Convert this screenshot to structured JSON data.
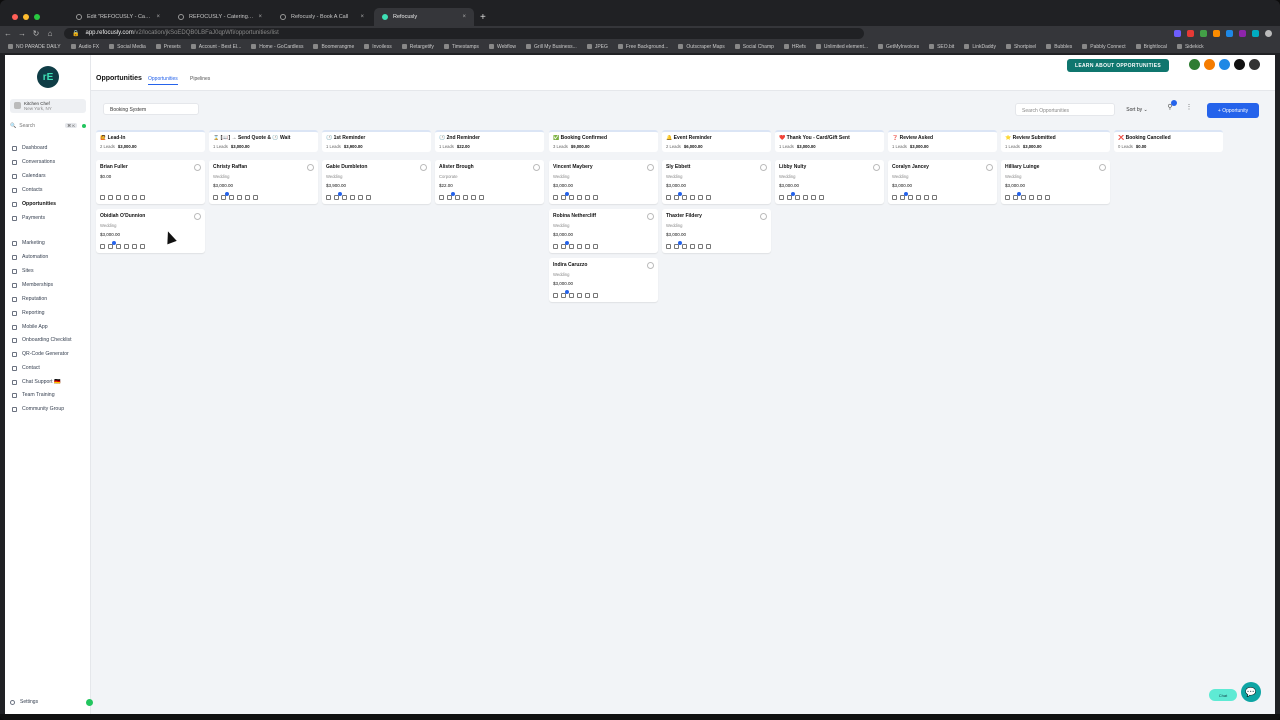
{
  "browser": {
    "tabs": [
      {
        "label": "Edit \"REFOCUSLY - Catering &"
      },
      {
        "label": "REFOCUSLY - Catering & Rei"
      },
      {
        "label": "Refocusly - Book A Call"
      },
      {
        "label": "Refocusly",
        "active": true
      }
    ],
    "url_host": "app.refocusly.com",
    "url_path": "/v2/location/jkSoEDQB0LBFaJ0qpWfi/opportunities/list",
    "bookmarks": [
      "NO PARADE DAILY",
      "Audio FX",
      "Social Media",
      "Presets",
      "Account - Best El...",
      "Home - GoCardless",
      "Boomerangme",
      "Invoiless",
      "Retargetify",
      "Timestamps",
      "Webflow",
      "Grill My Business...",
      "JPEG",
      "Free Background...",
      "Outscraper Maps",
      "Social Champ",
      "HRefs",
      "Unlimited element...",
      "GetMyInvoices",
      "SEO.bit",
      "LinkDaddy",
      "Shortpixel",
      "Bubbles",
      "Pabbly Connect",
      "Brightlocal",
      "Sidekick"
    ]
  },
  "account": {
    "name": "Kitchen Chef",
    "location": "New York, NY"
  },
  "sidebar": {
    "search": "Search",
    "shortcut": "⌘ K",
    "items": [
      {
        "label": "Dashboard"
      },
      {
        "label": "Conversations"
      },
      {
        "label": "Calendars"
      },
      {
        "label": "Contacts"
      },
      {
        "label": "Opportunities",
        "active": true
      },
      {
        "label": "Payments"
      },
      {
        "label": "Marketing"
      },
      {
        "label": "Automation"
      },
      {
        "label": "Sites"
      },
      {
        "label": "Memberships"
      },
      {
        "label": "Reputation"
      },
      {
        "label": "Reporting"
      },
      {
        "label": "Mobile App"
      },
      {
        "label": "Onboarding Checklist"
      },
      {
        "label": "QR-Code Generator"
      },
      {
        "label": "Contact"
      },
      {
        "label": "Chat Support 🇩🇪"
      },
      {
        "label": "Team Training"
      },
      {
        "label": "Community Group"
      }
    ],
    "settings": "Settings"
  },
  "header": {
    "title": "Opportunities",
    "tabs": [
      "Opportunities",
      "Pipelines"
    ],
    "learn_button": "LEARN ABOUT OPPORTUNITIES"
  },
  "toolbar": {
    "pipeline": "Booking System",
    "search_placeholder": "Search Opportunities",
    "sort": "Sort by",
    "add_button": "+ Opportunity"
  },
  "board": {
    "stages": [
      {
        "name": "🙋 Lead-In",
        "count": "2 Leads",
        "total": "$3,000.00",
        "cards": [
          {
            "name": "Brian Fuller",
            "source": "",
            "value": "$0.00"
          },
          {
            "name": "Obidiah O'Dunnion",
            "source": "Wedding",
            "value": "$3,000.00"
          }
        ]
      },
      {
        "name": "⌛ [📖] → Send Quote & 🕐 Wait",
        "count": "1 Leads",
        "total": "$3,000.00",
        "cards": [
          {
            "name": "Christy Raffan",
            "source": "Wedding",
            "value": "$3,000.00"
          }
        ]
      },
      {
        "name": "🕐 1st Reminder",
        "count": "1 Leads",
        "total": "$3,900.00",
        "cards": [
          {
            "name": "Gabie Dumbleton",
            "source": "Wedding",
            "value": "$3,900.00"
          }
        ]
      },
      {
        "name": "🕐 2nd Reminder",
        "count": "1 Leads",
        "total": "$22.00",
        "cards": [
          {
            "name": "Alister Brough",
            "source": "Corporate",
            "value": "$22.00"
          }
        ]
      },
      {
        "name": "✅ Booking Confirmed",
        "count": "3 Leads",
        "total": "$9,000.00",
        "cards": [
          {
            "name": "Vincent Maybery",
            "source": "Wedding",
            "value": "$3,000.00"
          },
          {
            "name": "Robina Nethercliff",
            "source": "Wedding",
            "value": "$3,000.00"
          },
          {
            "name": "Indira Caruzzo",
            "source": "Wedding",
            "value": "$3,000.00"
          }
        ]
      },
      {
        "name": "🔔 Event Reminder",
        "count": "2 Leads",
        "total": "$6,000.00",
        "cards": [
          {
            "name": "Sly Ebbett",
            "source": "Wedding",
            "value": "$3,000.00"
          },
          {
            "name": "Thaxter Fildery",
            "source": "Wedding",
            "value": "$3,000.00"
          }
        ]
      },
      {
        "name": "❤️ Thank You - Card/Gift Sent",
        "count": "1 Leads",
        "total": "$3,000.00",
        "cards": [
          {
            "name": "Libby Nulty",
            "source": "Wedding",
            "value": "$3,000.00"
          }
        ]
      },
      {
        "name": "❓ Review Asked",
        "count": "1 Leads",
        "total": "$3,000.00",
        "cards": [
          {
            "name": "Coralyn Jancey",
            "source": "Wedding",
            "value": "$3,000.00"
          }
        ]
      },
      {
        "name": "⭐ Review Submitted",
        "count": "1 Leads",
        "total": "$3,000.00",
        "cards": [
          {
            "name": "Hilliary Luinge",
            "source": "Wedding",
            "value": "$3,000.00"
          }
        ]
      },
      {
        "name": "❌ Booking Cancelled",
        "count": "0 Leads",
        "total": "$0.00",
        "cards": []
      }
    ]
  },
  "chat_widget": {
    "label": "Chat"
  },
  "colors": {
    "accent": "#2563eb",
    "brand": "#0f766e"
  }
}
